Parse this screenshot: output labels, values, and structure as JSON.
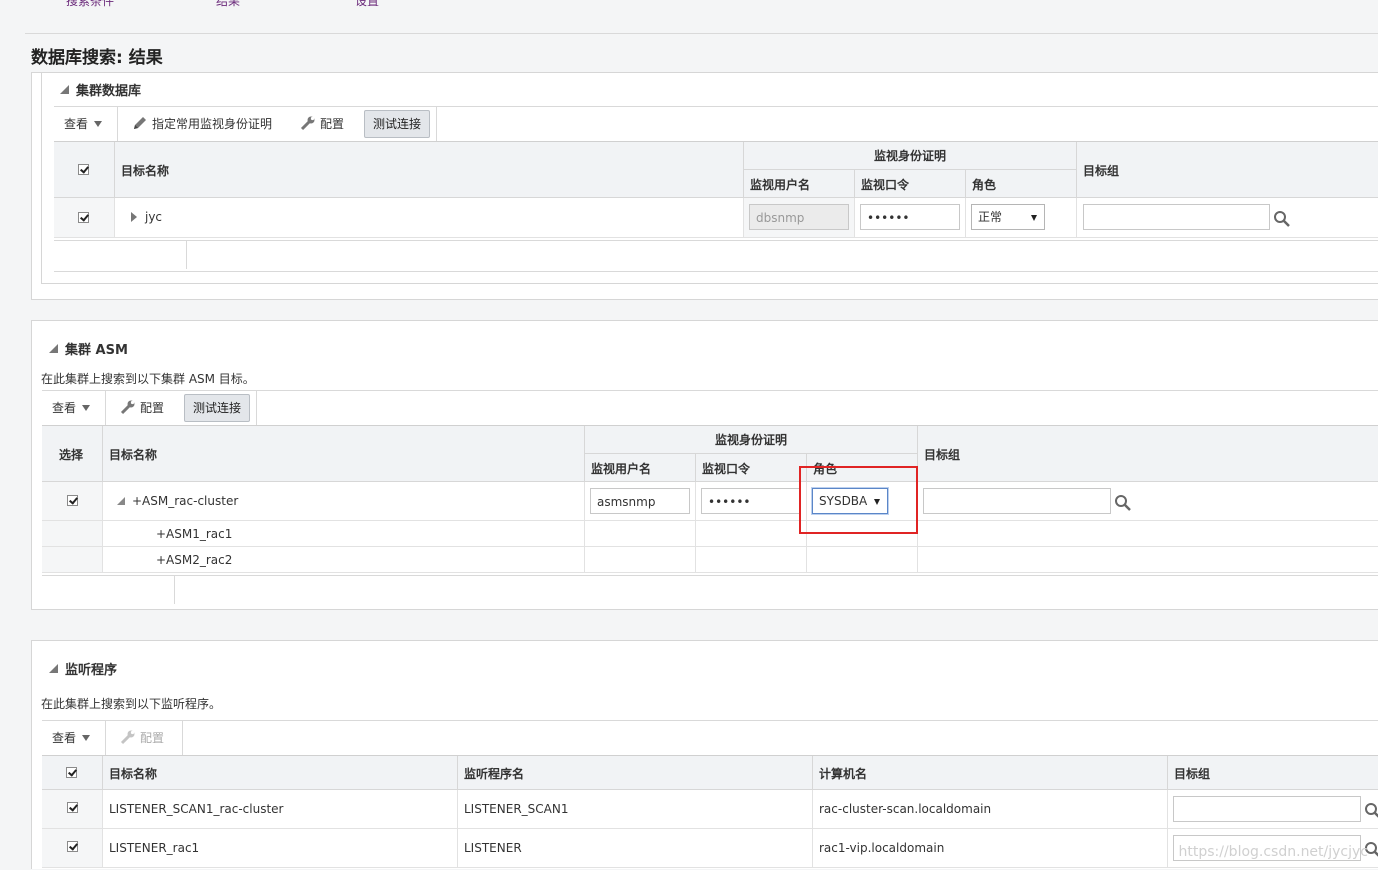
{
  "top_tabs": [
    "搜索条件",
    "结果",
    "设置"
  ],
  "page_title": "数据库搜索: 结果",
  "icons": {
    "pencil": "pencil-icon",
    "wrench": "wrench-icon",
    "search": "magnifier-icon",
    "expand": "triangle-right-icon",
    "collapse": "triangle-down-icon"
  },
  "cluster_db": {
    "title": "集群数据库",
    "toolbar": {
      "view": "查看",
      "assign": "指定常用监视身份证明",
      "config": "配置",
      "test": "测试连接"
    },
    "headers": {
      "target_name": "目标名称",
      "monitor_cred": "监视身份证明",
      "user": "监视用户名",
      "password": "监视口令",
      "role": "角色",
      "group": "目标组"
    },
    "rows": [
      {
        "name": "jyc",
        "user": "dbsnmp",
        "password": "••••••",
        "role": "正常",
        "group": ""
      }
    ]
  },
  "cluster_asm": {
    "title": "集群 ASM",
    "desc": "在此集群上搜索到以下集群 ASM 目标。",
    "toolbar": {
      "view": "查看",
      "config": "配置",
      "test": "测试连接"
    },
    "headers": {
      "select": "选择",
      "target_name": "目标名称",
      "monitor_cred": "监视身份证明",
      "user": "监视用户名",
      "password": "监视口令",
      "role": "角色",
      "group": "目标组"
    },
    "rows": [
      {
        "name": "+ASM_rac-cluster",
        "user": "asmsnmp",
        "password": "••••••",
        "role": "SYSDBA",
        "group": ""
      },
      {
        "name": "+ASM1_rac1"
      },
      {
        "name": "+ASM2_rac2"
      }
    ]
  },
  "listeners": {
    "title": "监听程序",
    "desc": "在此集群上搜索到以下监听程序。",
    "toolbar": {
      "view": "查看",
      "config": "配置"
    },
    "headers": {
      "target_name": "目标名称",
      "listener_name": "监听程序名",
      "host": "计算机名",
      "group": "目标组"
    },
    "rows": [
      {
        "name": "LISTENER_SCAN1_rac-cluster",
        "listener": "LISTENER_SCAN1",
        "host": "rac-cluster-scan.localdomain",
        "group": ""
      },
      {
        "name": "LISTENER_rac1",
        "listener": "LISTENER",
        "host": "rac1-vip.localdomain",
        "group": ""
      }
    ]
  },
  "watermark": "https://blog.csdn.net/jycjyc",
  "colors": {
    "highlight": "#e02424",
    "header_bg": "#f1f3f5",
    "link": "#6b2a7b"
  }
}
